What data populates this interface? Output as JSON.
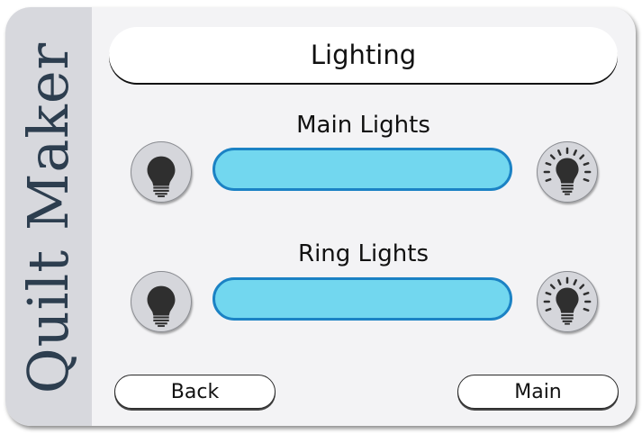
{
  "brand": {
    "name": "Quilt Maker"
  },
  "title": "Lighting",
  "sections": [
    {
      "label": "Main Lights",
      "dim_icon": "lightbulb-icon",
      "bright_icon": "lightbulb-bright-icon",
      "level": 1.0
    },
    {
      "label": "Ring Lights",
      "dim_icon": "lightbulb-icon",
      "bright_icon": "lightbulb-bright-icon",
      "level": 1.0
    }
  ],
  "nav": {
    "back_label": "Back",
    "main_label": "Main"
  },
  "colors": {
    "panel": "#f3f3f5",
    "brand_strip": "#d7d8dd",
    "brand_text": "#2d3e4f",
    "slider_fill": "#72d7ef",
    "slider_border": "#1b82c4",
    "icon_button": "#d5d6db",
    "icon": "#2f2f2f"
  }
}
